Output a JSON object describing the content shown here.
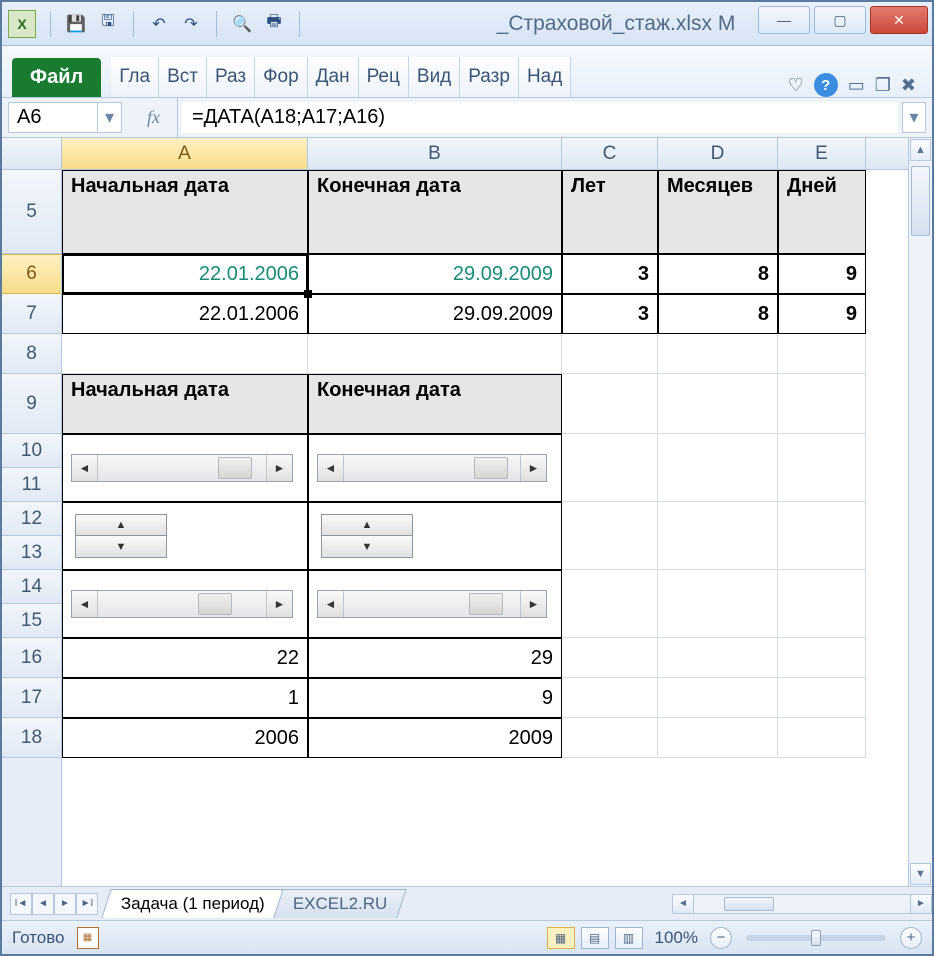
{
  "titlebar": {
    "filename": "_Страховой_стаж.xlsx M"
  },
  "ribbon": {
    "file": "Файл",
    "tabs": [
      "Гла",
      "Вст",
      "Раз",
      "Фор",
      "Дан",
      "Рец",
      "Вид",
      "Разр",
      "Над"
    ]
  },
  "formula_bar": {
    "cell_ref": "A6",
    "fx_label": "fx",
    "formula": "=ДАТА(A18;A17;A16)"
  },
  "columns": [
    "A",
    "B",
    "C",
    "D",
    "E"
  ],
  "row_heights": {
    "header_row": 5
  },
  "headers": {
    "start_date": "Начальная дата",
    "end_date": "Конечная дата",
    "years": "Лет",
    "months": "Месяцев",
    "days": "Дней"
  },
  "rows": {
    "r6": {
      "A": "22.01.2006",
      "B": "29.09.2009",
      "C": "3",
      "D": "8",
      "E": "9"
    },
    "r7": {
      "A": "22.01.2006",
      "B": "29.09.2009",
      "C": "3",
      "D": "8",
      "E": "9"
    },
    "r16": {
      "A": "22",
      "B": "29"
    },
    "r17": {
      "A": "1",
      "B": "9"
    },
    "r18": {
      "A": "2006",
      "B": "2009"
    }
  },
  "row_labels": [
    "5",
    "6",
    "7",
    "8",
    "9",
    "10",
    "11",
    "12",
    "13",
    "14",
    "15",
    "16",
    "17",
    "18"
  ],
  "sheet_tabs": {
    "active": "Задача (1 период)",
    "inactive": "EXCEL2.RU"
  },
  "statusbar": {
    "ready": "Готово",
    "zoom": "100%"
  }
}
